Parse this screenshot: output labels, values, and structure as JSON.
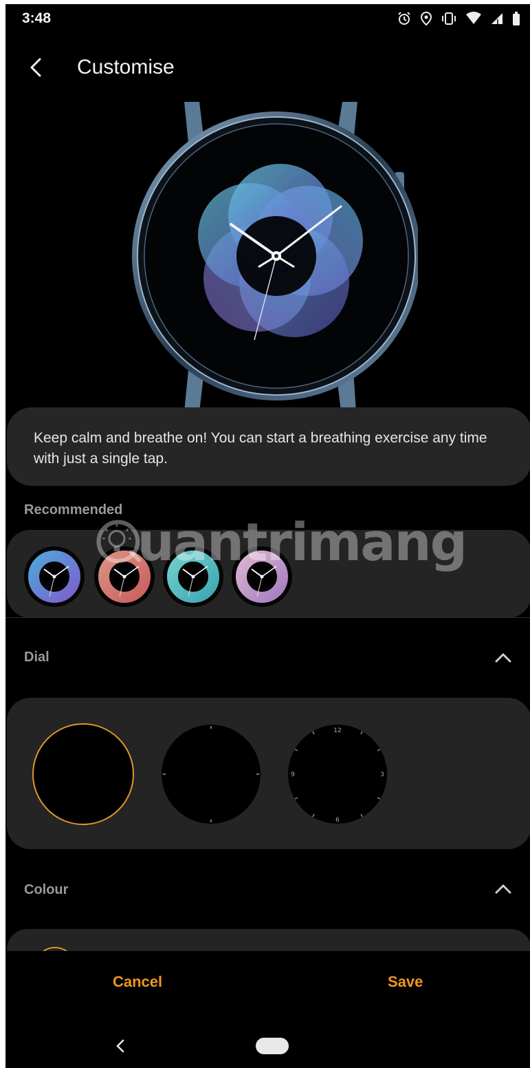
{
  "status_bar": {
    "time": "3:48",
    "icons": [
      "alarm-icon",
      "location-icon",
      "vibrate-icon",
      "wifi-icon",
      "signal-icon",
      "battery-icon"
    ]
  },
  "header": {
    "back_icon": "chevron-left-icon",
    "title": "Customise"
  },
  "watch_preview": {
    "face": "breathing-gradient-face",
    "colors": [
      "#5fd0e8",
      "#7a6ce0",
      "#b070d8"
    ]
  },
  "info": {
    "text": "Keep calm and breathe on! You can start a breathing exercise any time with just a single tap."
  },
  "recommended": {
    "label": "Recommended",
    "items": [
      {
        "name": "blue-purple",
        "colors": [
          "#5ab6f0",
          "#8a6ae6"
        ]
      },
      {
        "name": "coral",
        "colors": [
          "#f0a090",
          "#e06a6a"
        ]
      },
      {
        "name": "teal",
        "colors": [
          "#7ae6e0",
          "#46b8c8"
        ]
      },
      {
        "name": "lavender",
        "colors": [
          "#f0c8e6",
          "#b88ad6"
        ]
      }
    ]
  },
  "watermark": {
    "text": "uantrimang",
    "icon": "lightbulb-logo-icon"
  },
  "dial": {
    "label": "Dial",
    "collapse_icon": "chevron-up-icon",
    "options": [
      {
        "name": "plain",
        "selected": true
      },
      {
        "name": "minute-ticks",
        "selected": false
      },
      {
        "name": "numerals",
        "selected": false
      }
    ]
  },
  "colour": {
    "label": "Colour",
    "collapse_icon": "chevron-up-icon"
  },
  "actions": {
    "cancel_label": "Cancel",
    "save_label": "Save"
  },
  "nav_bar": {
    "back_icon": "nav-back-icon",
    "home_icon": "nav-home-pill-icon"
  },
  "accent_color": "#f0961e"
}
